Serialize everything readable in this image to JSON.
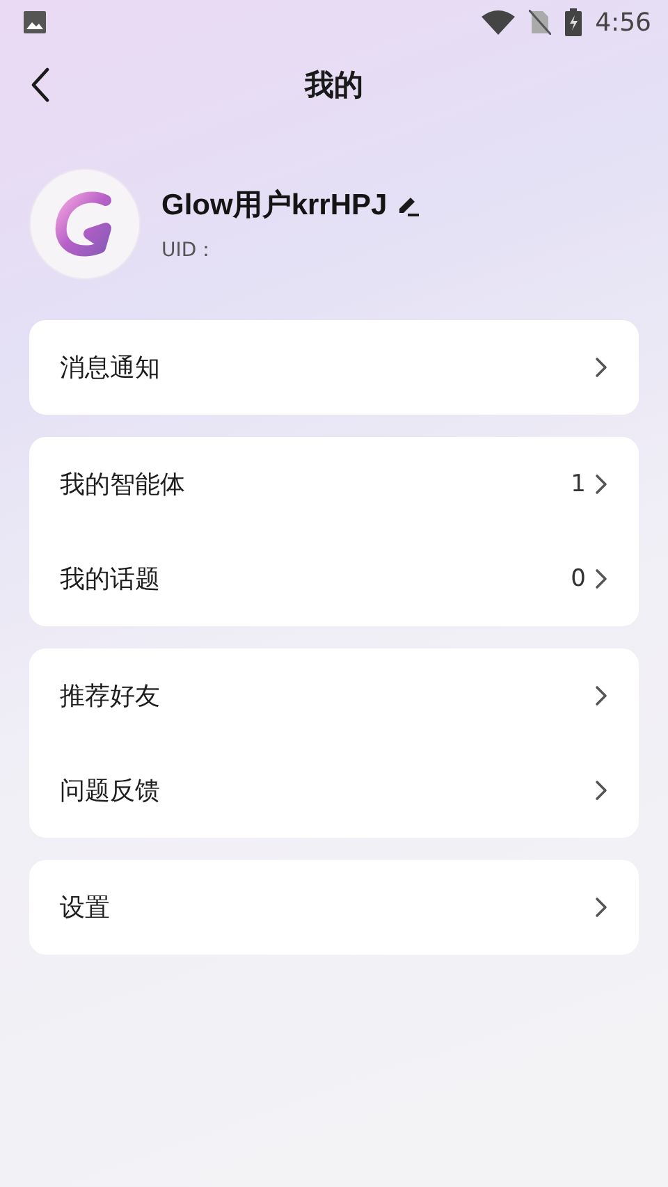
{
  "status_bar": {
    "time": "4:56"
  },
  "header": {
    "title": "我的"
  },
  "profile": {
    "name": "Glow用户krrHPJ",
    "uid_label": "UID："
  },
  "menu_groups": [
    {
      "items": [
        {
          "label": "消息通知"
        }
      ]
    },
    {
      "items": [
        {
          "label": "我的智能体",
          "count": "1"
        },
        {
          "label": "我的话题",
          "count": "0"
        }
      ]
    },
    {
      "items": [
        {
          "label": "推荐好友"
        },
        {
          "label": "问题反馈"
        }
      ]
    },
    {
      "items": [
        {
          "label": "设置"
        }
      ]
    }
  ]
}
